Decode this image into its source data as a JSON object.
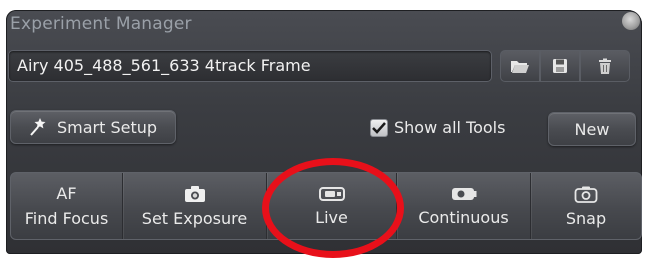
{
  "window": {
    "title": "Experiment Manager"
  },
  "config": {
    "selected": "Airy 405_488_561_633 4track Frame"
  },
  "toolbar_icons": [
    "folder-open-icon",
    "save-icon",
    "trash-icon"
  ],
  "smart_setup": {
    "label": "Smart Setup",
    "icon": "magic-wand-icon"
  },
  "show_all_tools": {
    "label": "Show all Tools",
    "checked": true
  },
  "new_button": {
    "label": "New"
  },
  "actions": [
    {
      "label": "Find Focus",
      "caption": "AF"
    },
    {
      "label": "Set Exposure",
      "icon": "camera-icon"
    },
    {
      "label": "Live",
      "icon": "live-camera-icon"
    },
    {
      "label": "Continuous",
      "icon": "continuous-camera-icon"
    },
    {
      "label": "Snap",
      "icon": "snap-camera-icon"
    }
  ],
  "colors": {
    "panel": "#3b3d42",
    "text": "#eaeaea",
    "title": "#9aa0a8",
    "highlight": "#e8101a"
  }
}
